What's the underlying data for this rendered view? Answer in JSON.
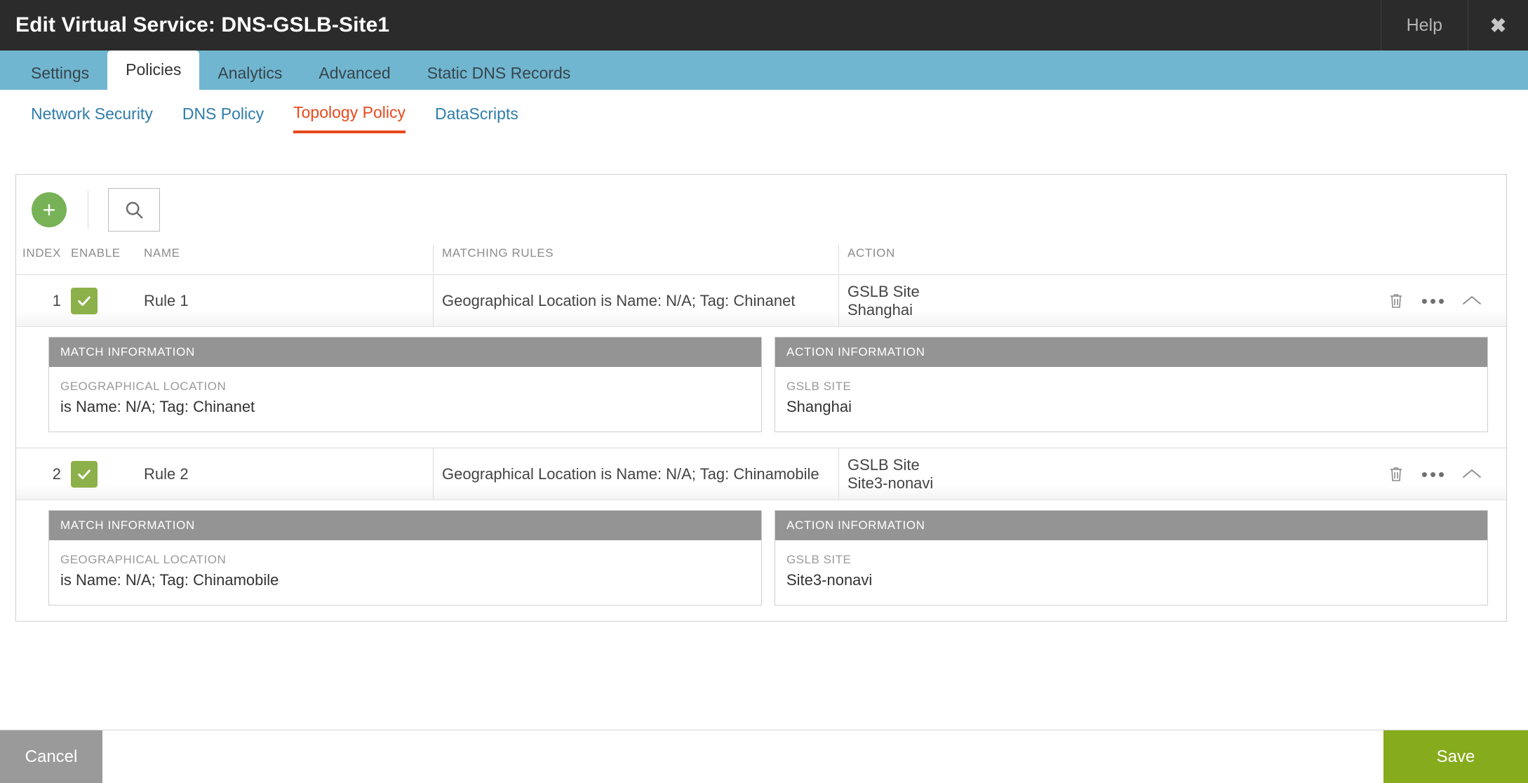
{
  "window": {
    "title": "Edit Virtual Service: DNS-GSLB-Site1",
    "help_label": "Help",
    "close_label": "✖"
  },
  "tabs": [
    {
      "label": "Settings",
      "active": false
    },
    {
      "label": "Policies",
      "active": true
    },
    {
      "label": "Analytics",
      "active": false
    },
    {
      "label": "Advanced",
      "active": false
    },
    {
      "label": "Static DNS Records",
      "active": false
    }
  ],
  "subtabs": [
    {
      "label": "Network Security",
      "active": false
    },
    {
      "label": "DNS Policy",
      "active": false
    },
    {
      "label": "Topology Policy",
      "active": true
    },
    {
      "label": "DataScripts",
      "active": false
    }
  ],
  "toolbar": {
    "add_label": "+",
    "add_icon": "plus-icon",
    "search_icon": "search-icon"
  },
  "table": {
    "columns": {
      "index": "INDEX",
      "enable": "ENABLE",
      "name": "NAME",
      "matching_rules": "MATCHING RULES",
      "action": "ACTION"
    },
    "rows": [
      {
        "index": "1",
        "enabled": true,
        "name": "Rule 1",
        "matching_rules": "Geographical Location is Name: N/A; Tag: Chinanet",
        "action_label": "GSLB Site",
        "action_value": "Shanghai",
        "detail": {
          "match_header": "MATCH INFORMATION",
          "match_field_label": "GEOGRAPHICAL LOCATION",
          "match_field_value": "is Name: N/A; Tag: Chinanet",
          "action_header": "ACTION INFORMATION",
          "action_field_label": "GSLB SITE",
          "action_field_value": "Shanghai"
        }
      },
      {
        "index": "2",
        "enabled": true,
        "name": "Rule 2",
        "matching_rules": "Geographical Location is Name: N/A; Tag: Chinamobile",
        "action_label": "GSLB Site",
        "action_value": "Site3-nonavi",
        "detail": {
          "match_header": "MATCH INFORMATION",
          "match_field_label": "GEOGRAPHICAL LOCATION",
          "match_field_value": "is Name: N/A; Tag: Chinamobile",
          "action_header": "ACTION INFORMATION",
          "action_field_label": "GSLB SITE",
          "action_field_value": "Site3-nonavi"
        }
      }
    ],
    "row_ops": {
      "delete_icon": "trash-icon",
      "more_icon": "ellipsis-icon",
      "collapse_icon": "chevron-up-icon"
    }
  },
  "footer": {
    "cancel_label": "Cancel",
    "save_label": "Save"
  },
  "colors": {
    "titlebar": "#2b2b2b",
    "tabstrip": "#71b6d0",
    "active_subtab": "#e8491d",
    "link": "#2f7dab",
    "add_button": "#78b257",
    "checkbox": "#8db14a",
    "panel_header": "#949494",
    "save_button": "#86ab1c",
    "cancel_button": "#9a9a9a"
  }
}
